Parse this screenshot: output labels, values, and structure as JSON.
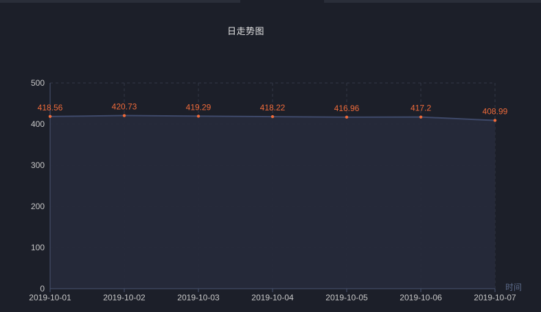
{
  "chart_data": {
    "type": "area",
    "title": "日走势图",
    "xlabel": "时间",
    "ylabel": "",
    "categories": [
      "2019-10-01",
      "2019-10-02",
      "2019-10-03",
      "2019-10-04",
      "2019-10-05",
      "2019-10-06",
      "2019-10-07"
    ],
    "values": [
      418.56,
      420.73,
      419.29,
      418.22,
      416.96,
      417.2,
      408.99
    ],
    "data_labels": [
      "418.56",
      "420.73",
      "419.29",
      "418.22",
      "416.96",
      "417.2",
      "408.99"
    ],
    "y_ticks": [
      "0",
      "100",
      "200",
      "300",
      "400",
      "500"
    ],
    "ylim": [
      0,
      500
    ],
    "grid": true,
    "colors": {
      "line": "#3f4a6b",
      "area": "#262a3a",
      "point": "#f06b3a",
      "label": "#f06b3a",
      "axis": "#4a5573",
      "grid": "#333847"
    }
  }
}
